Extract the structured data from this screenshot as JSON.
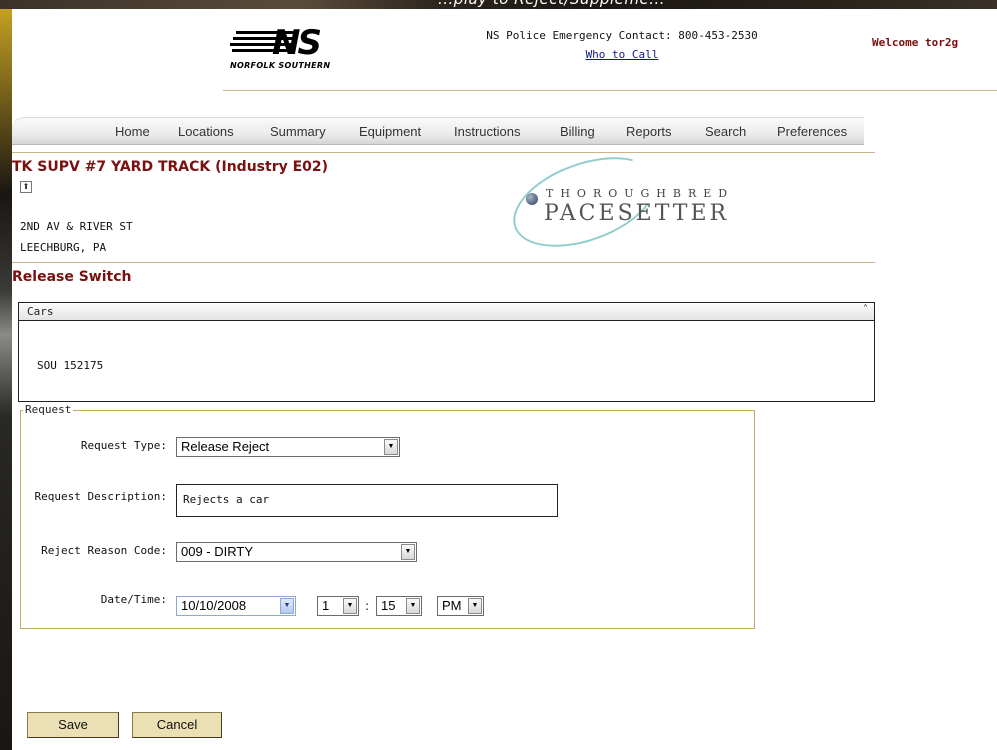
{
  "top_overlay_text": "...play to Reject/Suppleme...",
  "header": {
    "logo": {
      "mark": "NS",
      "subtitle": "NORFOLK SOUTHERN"
    },
    "police_contact": "NS Police Emergency Contact: 800-453-2530",
    "who_to_call": "Who to Call",
    "welcome": "Welcome  tor2g"
  },
  "nav": {
    "items": [
      "Home",
      "Locations",
      "Summary",
      "Equipment",
      "Instructions",
      "Billing",
      "Reports",
      "Search",
      "Preferences"
    ]
  },
  "location": {
    "title": "TK SUPV #7 YARD TRACK (Industry E02)",
    "collapse_icon": "collapse-up-icon",
    "address_line1": "2ND AV & RIVER ST",
    "address_line2": "LEECHBURG, PA"
  },
  "branding": {
    "line1": "THOROUGHBRED",
    "line2": "PACESETTER"
  },
  "section_title": "Release Switch",
  "cars": {
    "header": "Cars",
    "toggle_icon": "collapse-up-icon",
    "items": [
      "SOU 152175"
    ]
  },
  "request": {
    "legend": "Request",
    "request_type_label": "Request Type:",
    "request_type_value": "Release Reject",
    "description_label": "Request Description:",
    "description_value": "Rejects a car",
    "reason_label": "Reject Reason Code:",
    "reason_value": "009 - DIRTY",
    "datetime_label": "Date/Time:",
    "date_value": "10/10/2008",
    "hour_value": "1",
    "minute_value": "15",
    "ampm_value": "PM",
    "time_separator": ":"
  },
  "buttons": {
    "save": "Save",
    "cancel": "Cancel"
  },
  "colors": {
    "title_red": "#7a1010",
    "welcome_red": "#7a0b0b",
    "link_blue": "#0f1a88",
    "button_tan": "#ebdfb4",
    "fieldset_border": "#c8a760"
  }
}
